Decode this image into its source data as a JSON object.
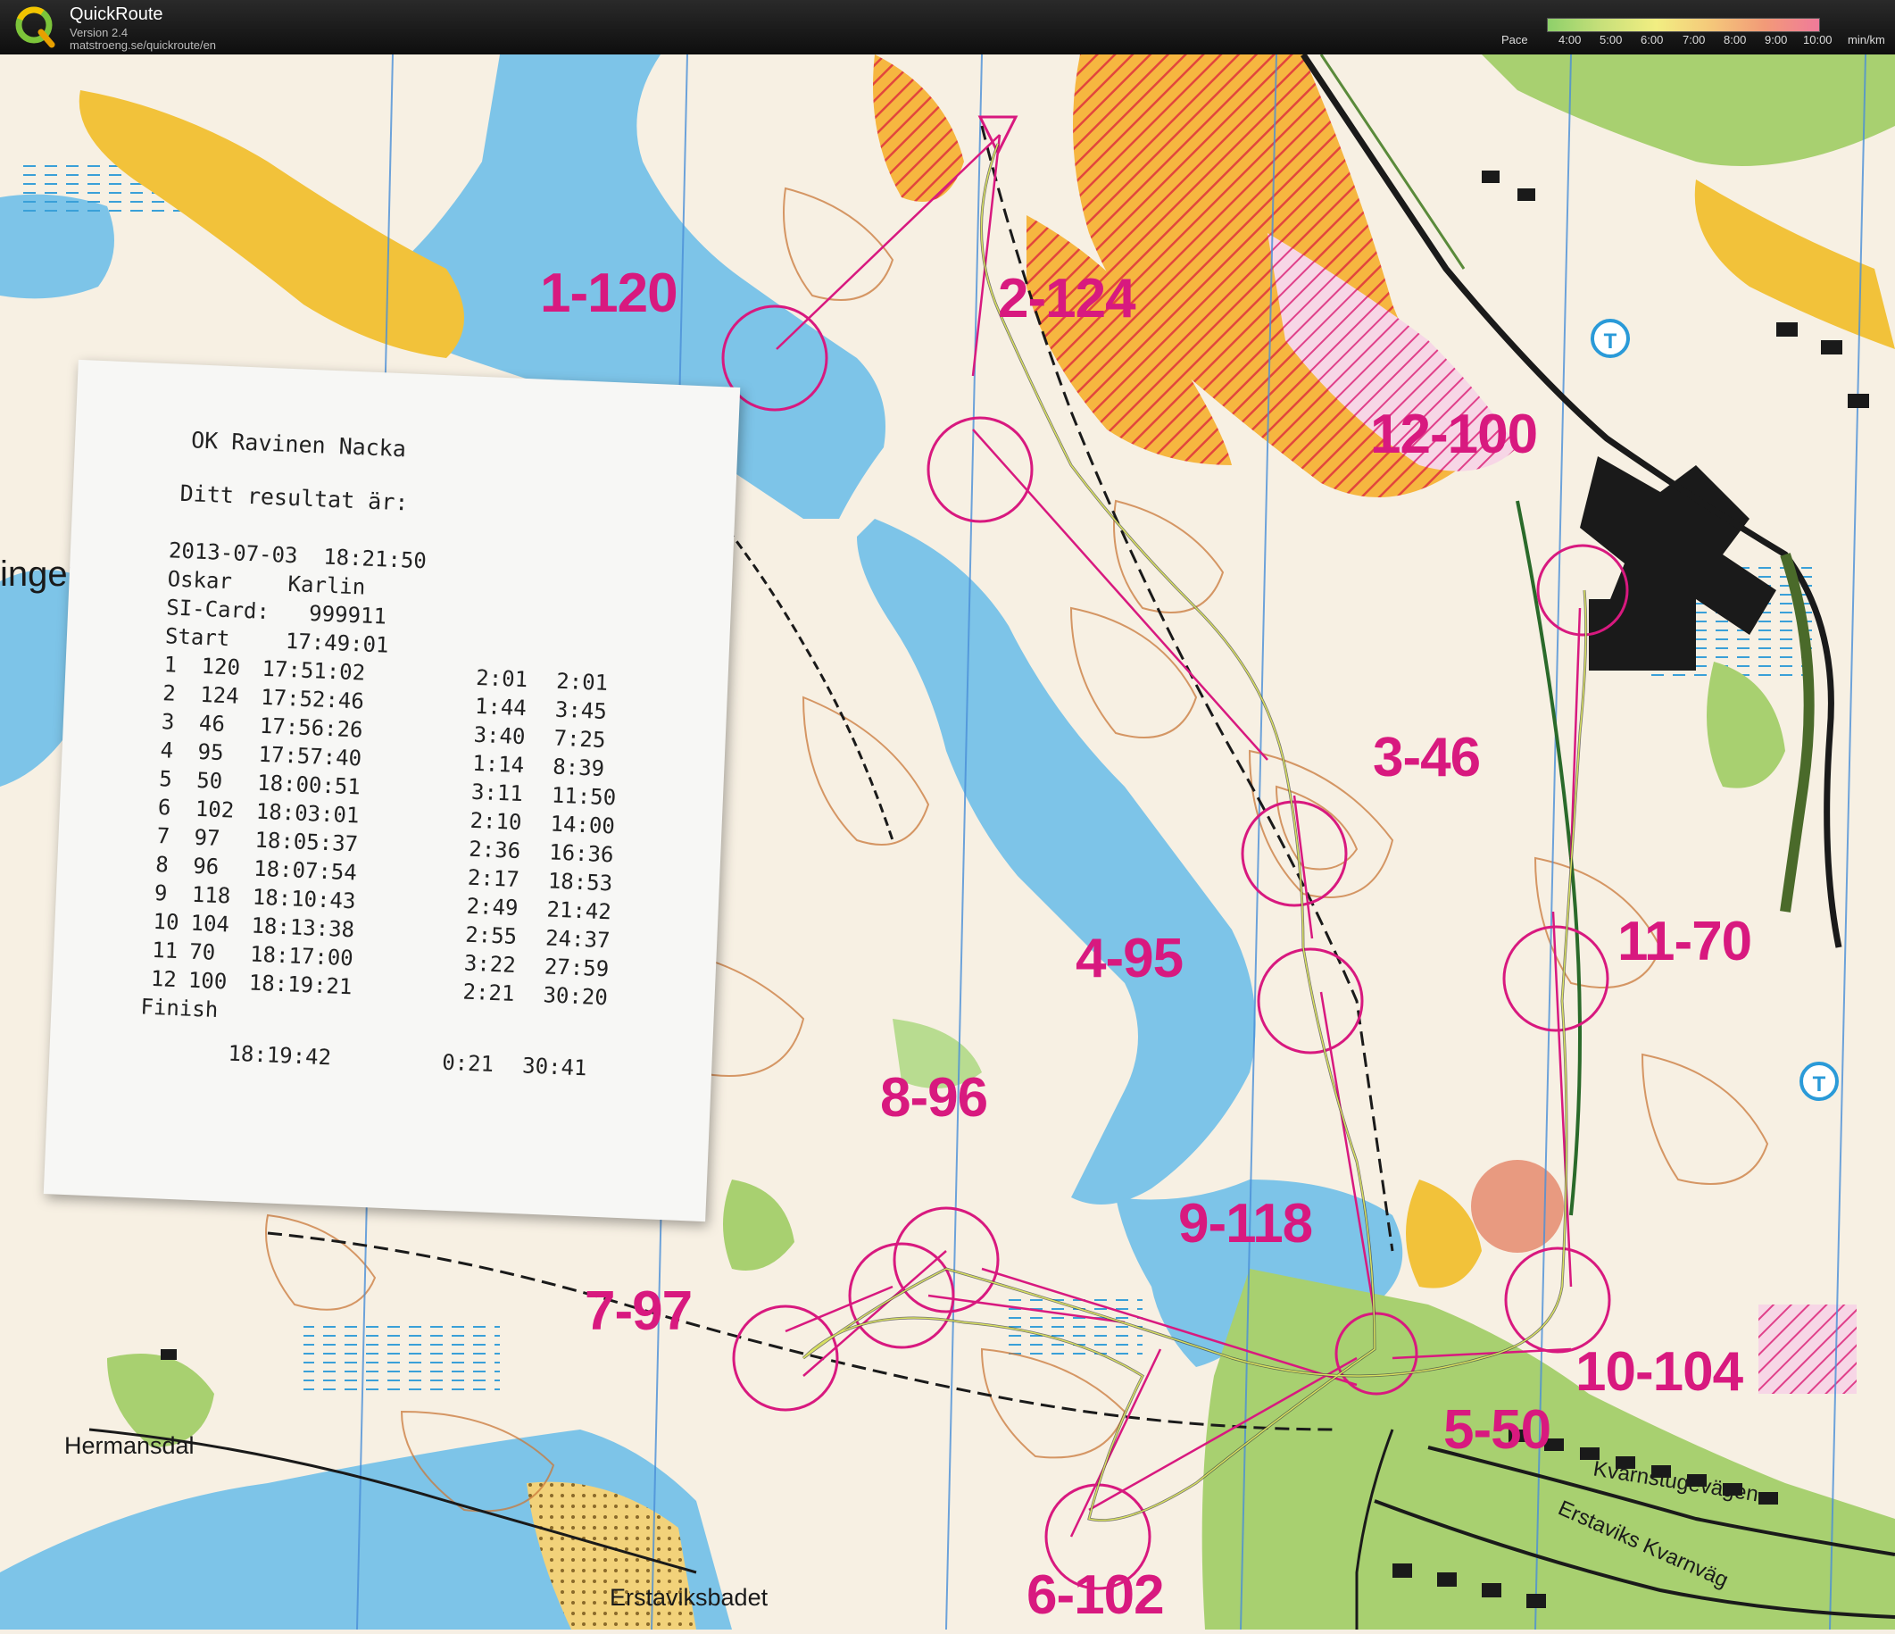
{
  "app": {
    "title": "QuickRoute",
    "version": "Version 2.4",
    "url": "matstroeng.se/quickroute/en",
    "pace_label": "Pace",
    "pace_ticks": [
      "4:00",
      "5:00",
      "6:00",
      "7:00",
      "8:00",
      "9:00",
      "10:00"
    ],
    "pace_unit": "min/km"
  },
  "map": {
    "controls": [
      {
        "label": "1-120"
      },
      {
        "label": "2-124"
      },
      {
        "label": "12-100"
      },
      {
        "label": "3-46"
      },
      {
        "label": "4-95"
      },
      {
        "label": "11-70"
      },
      {
        "label": "8-96"
      },
      {
        "label": "9-118"
      },
      {
        "label": "7-97"
      },
      {
        "label": "10-104"
      },
      {
        "label": "5-50"
      },
      {
        "label": "6-102"
      }
    ],
    "places": {
      "hermansdal": "Hermansdal",
      "erstaviksbadet": "Erstaviksbadet",
      "kvarnstugevagen": "Kvarnstugevägen",
      "erstaviks_kvarnvag": "Erstaviks Kvarnväg",
      "lake_fragment": "ingen"
    }
  },
  "receipt": {
    "club": "OK Ravinen Nacka",
    "result_heading": "Ditt resultat är:",
    "datetime": "2013-07-03  18:21:50",
    "first_name": "Oskar",
    "last_name": "Karlin",
    "si_label": "SI-Card:",
    "si_number": "999911",
    "start_label": "Start",
    "start_time": "17:49:01",
    "splits": [
      {
        "n": "1",
        "code": "120",
        "time": "17:51:02",
        "leg": "2:01",
        "total": "2:01"
      },
      {
        "n": "2",
        "code": "124",
        "time": "17:52:46",
        "leg": "1:44",
        "total": "3:45"
      },
      {
        "n": "3",
        "code": "46",
        "time": "17:56:26",
        "leg": "3:40",
        "total": "7:25"
      },
      {
        "n": "4",
        "code": "95",
        "time": "17:57:40",
        "leg": "1:14",
        "total": "8:39"
      },
      {
        "n": "5",
        "code": "50",
        "time": "18:00:51",
        "leg": "3:11",
        "total": "11:50"
      },
      {
        "n": "6",
        "code": "102",
        "time": "18:03:01",
        "leg": "2:10",
        "total": "14:00"
      },
      {
        "n": "7",
        "code": "97",
        "time": "18:05:37",
        "leg": "2:36",
        "total": "16:36"
      },
      {
        "n": "8",
        "code": "96",
        "time": "18:07:54",
        "leg": "2:17",
        "total": "18:53"
      },
      {
        "n": "9",
        "code": "118",
        "time": "18:10:43",
        "leg": "2:49",
        "total": "21:42"
      },
      {
        "n": "10",
        "code": "104",
        "time": "18:13:38",
        "leg": "2:55",
        "total": "24:37"
      },
      {
        "n": "11",
        "code": "70",
        "time": "18:17:00",
        "leg": "3:22",
        "total": "27:59"
      },
      {
        "n": "12",
        "code": "100",
        "time": "18:19:21",
        "leg": "2:21",
        "total": "30:20"
      }
    ],
    "finish_label": "Finish",
    "finish_time": "18:19:42",
    "finish_leg": "0:21",
    "finish_total": "30:41"
  },
  "colors": {
    "water": "#7dc4e8",
    "course": "#d8197f",
    "forbidden": "#f0a020",
    "open_land": "#f2c23a",
    "green": "#9ccc6a",
    "contour": "#c9783a",
    "road": "#1a1a1a"
  }
}
